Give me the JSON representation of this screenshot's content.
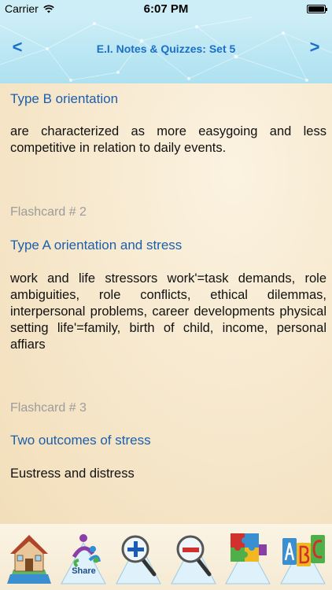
{
  "status_bar": {
    "carrier": "Carrier",
    "time": "6:07 PM"
  },
  "nav": {
    "title": "E.I. Notes & Quizzes: Set 5",
    "back_label": "<",
    "forward_label": ">"
  },
  "cards": [
    {
      "heading": "",
      "term": "Type B orientation",
      "definition": "are characterized as more easygoing and less competitive in relation to daily events."
    },
    {
      "heading": "Flashcard # 2",
      "term": "Type A orientation and stress",
      "definition": "work and life stressors work'=task demands, role ambiguities, role conflicts, ethical dilemmas, interpersonal problems, career developments physical setting life'=family, birth of child, income, personal affiars"
    },
    {
      "heading": "Flashcard # 3",
      "term": "Two outcomes of stress",
      "definition": "Eustress and distress"
    }
  ],
  "tabs": [
    {
      "icon": "home-icon",
      "label": ""
    },
    {
      "icon": "share-icon",
      "label": "Share"
    },
    {
      "icon": "zoom-in-icon",
      "label": ""
    },
    {
      "icon": "zoom-out-icon",
      "label": ""
    },
    {
      "icon": "puzzle-icon",
      "label": ""
    },
    {
      "icon": "abc-blocks-icon",
      "label": ""
    }
  ],
  "colors": {
    "accent": "#1a6fc8",
    "term": "#1b5fad",
    "heading": "#9c9c9c",
    "background": "#f6e7cb",
    "nav_background": "#bfe8f4"
  }
}
